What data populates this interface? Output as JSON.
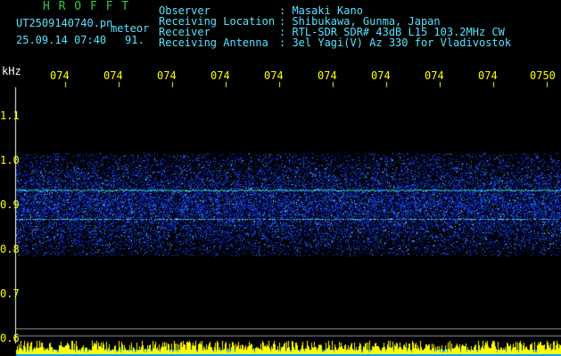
{
  "header": {
    "app_name": "H R O F F T",
    "file_name": "UT2509140740.pn",
    "meteor_label": "meteor",
    "datetime": "25.09.14 07:40",
    "count": "91.",
    "info_labels": [
      "Observer",
      "Receiving Location",
      "Receiver",
      "Receiving Antenna"
    ],
    "info_values": [
      ": Masaki Kano",
      ": Shibukawa, Gunma, Japan",
      ": RTL-SDR SDR# 43dB L15 103.2MHz CW",
      ": 3el Yagi(V) Az 330 for Vladivostok"
    ]
  },
  "spectrogram": {
    "unit_label": "kHz",
    "y_ticks": [
      "1.1",
      "1.0",
      "0.9",
      "0.8",
      "0.7",
      "0.6"
    ],
    "x_ticks": [
      "074",
      "074",
      "074",
      "074",
      "074",
      "074",
      "074",
      "074",
      "074",
      "0750"
    ],
    "colors": {
      "background": "#000000",
      "noise": "#1e3cff",
      "trace": "#40ff80",
      "bar": "#ffff00",
      "bar_base": "#00a0ff"
    }
  }
}
